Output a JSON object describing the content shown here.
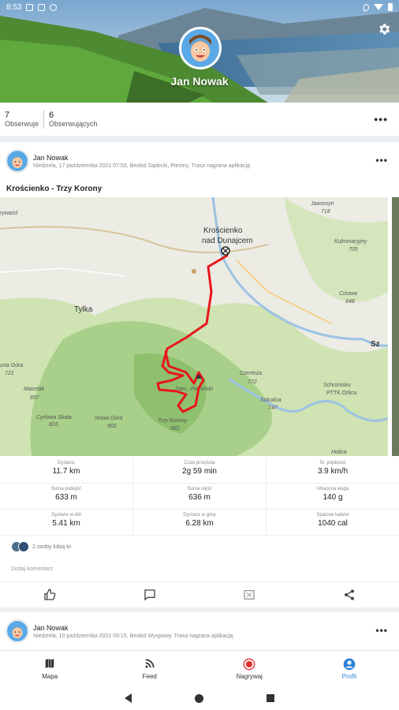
{
  "status_bar": {
    "time": "8:53"
  },
  "profile": {
    "name": "Jan Nowak",
    "following_count": "7",
    "following_label": "Obserwuje",
    "followers_count": "6",
    "followers_label": "Obserwujących"
  },
  "post1": {
    "author": "Jan Nowak",
    "subtitle": "Niedziela, 17 października 2021 07:53, Beskid Sądecki, Pieniny. Trasa nagrana aplikacją",
    "title": "Krościenko - Trzy Korony",
    "map_labels": {
      "town": "Krościenko",
      "town2": "nad Dunajcem",
      "tylka": "Tylka",
      "jaworzyn": "Jaworzyn",
      "jaworzyn_h": "718",
      "kulmin": "Kulminacyjny",
      "kulmin_h": "705",
      "cizowa": "Ciżowa",
      "cizowa_h": "648",
      "luna": "una Góra",
      "luna_h": "721",
      "macelak": "Macelak",
      "macelak_h": "857",
      "cyrlowa": "Cyrlowa Skała",
      "cyrlowa_h": "816",
      "nowa": "Nowa Góra",
      "nowa_h": "902",
      "czerteza": "Czerteża",
      "czerteza_h": "772",
      "sokolica": "Sokolica",
      "sokolica_h": "747",
      "schronisko": "Schronisko",
      "schronisko2": "PTTK Orlica",
      "trzy": "Trzy Korony",
      "trzy_h": "982",
      "zamkowa": "Zam...Pieniński",
      "holica": "Holica",
      "edge": "Sz",
      "ryvald": "ryważd"
    },
    "metrics": [
      [
        {
          "label": "Dystans",
          "value": "11.7 km"
        },
        {
          "label": "Czas przejścia",
          "value": "2g 59 min"
        },
        {
          "label": "Śr. prędkość",
          "value": "3.9 km/h"
        }
      ],
      [
        {
          "label": "Suma podejść",
          "value": "633 m"
        },
        {
          "label": "Suma zejść",
          "value": "636 m"
        },
        {
          "label": "Utracona waga",
          "value": "140 g"
        }
      ],
      [
        {
          "label": "Dystans w dół",
          "value": "5.41 km"
        },
        {
          "label": "Dystans w górę",
          "value": "6.28 km"
        },
        {
          "label": "Spalone kalorie",
          "value": "1040 cal"
        }
      ]
    ],
    "likes_text": "2 osoby lubią to",
    "add_comment": "Dodaj komentarz"
  },
  "post2": {
    "author": "Jan Nowak",
    "subtitle": "Niedziela, 10 października 2021 09:15, Beskid Wyspowy. Trasa nagrana aplikacją"
  },
  "nav": {
    "map": "Mapa",
    "feed": "Feed",
    "record": "Nagrywaj",
    "profile": "Profil"
  },
  "colors": {
    "accent": "#2a7fd4",
    "route": "#e8161b",
    "record": "#e52b2b"
  }
}
